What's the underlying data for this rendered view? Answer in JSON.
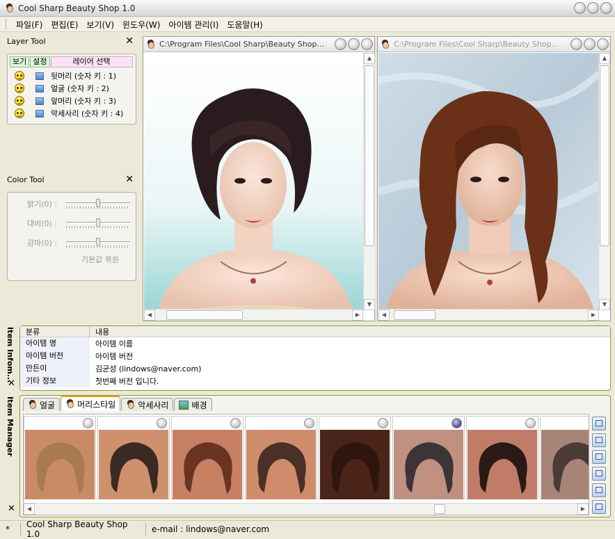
{
  "app": {
    "title": "Cool Sharp Beauty Shop 1.0"
  },
  "menu": [
    {
      "label": "파일(F)"
    },
    {
      "label": "편집(E)"
    },
    {
      "label": "보기(V)"
    },
    {
      "label": "윈도우(W)"
    },
    {
      "label": "아이템 관리(I)"
    },
    {
      "label": "도움말(H)"
    }
  ],
  "layer_tool": {
    "title": "Layer Tool",
    "close": "✕",
    "btn_view": "보기",
    "btn_settings": "설정",
    "btn_select": "레이어 선택",
    "layers": [
      {
        "label": "뒷머리 (숫자 키 : 1)"
      },
      {
        "label": "얼굴 (숫자 키 : 2)"
      },
      {
        "label": "앞머리 (숫자 키 : 3)"
      },
      {
        "label": "악세사리 (숫자 키 : 4)"
      }
    ]
  },
  "color_tool": {
    "title": "Color Tool",
    "close": "✕",
    "sliders": [
      {
        "label": "밝기(0) :",
        "value": 0.5
      },
      {
        "label": "대비(0) :",
        "value": 0.5
      },
      {
        "label": "감마(0) :",
        "value": 0.5
      }
    ],
    "reset_label": "기본값 복원"
  },
  "windows": [
    {
      "path": "C:\\Program Files\\Cool Sharp\\Beauty Shop..."
    },
    {
      "path": "C:\\Program Files\\Cool Sharp\\Beauty Shop..."
    }
  ],
  "item_info": {
    "sidebar": "Item Infom...",
    "close": "✕",
    "col_category": "분류",
    "col_content": "내용",
    "rows": [
      {
        "key": "아이템 명",
        "value": "아이템 이름"
      },
      {
        "key": "아이템 버전",
        "value": "아이템 버전"
      },
      {
        "key": "만든이",
        "value": "김균성 (lindows@naver.com)"
      },
      {
        "key": "기타 정보",
        "value": "첫번째 버전 입니다."
      }
    ]
  },
  "item_manager": {
    "sidebar": "Item Manager",
    "close": "✕",
    "tabs": [
      {
        "label": "얼굴"
      },
      {
        "label": "머리스타일"
      },
      {
        "label": "악세사리"
      },
      {
        "label": "배경"
      }
    ],
    "active_tab": "머리스타일",
    "tiles": [
      {
        "bg": "#c98a68",
        "hair": "#a87a50"
      },
      {
        "bg": "#cf906e",
        "hair": "#3a2a24"
      },
      {
        "bg": "#c78062",
        "hair": "#6a3422"
      },
      {
        "bg": "#cf8c6c",
        "hair": "#4a3026"
      },
      {
        "bg": "#4a2418",
        "hair": "#2e150e"
      },
      {
        "bg": "#c09080",
        "hair": "#3c3436"
      },
      {
        "bg": "#c07c66",
        "hair": "#2a1a16"
      },
      {
        "bg": "#a88478",
        "hair": "#4a3a38"
      }
    ],
    "selected_tile": 5
  },
  "status": {
    "mark": "*",
    "app": "Cool Sharp Beauty Shop 1.0",
    "email": "e-mail : lindows@naver.com"
  }
}
